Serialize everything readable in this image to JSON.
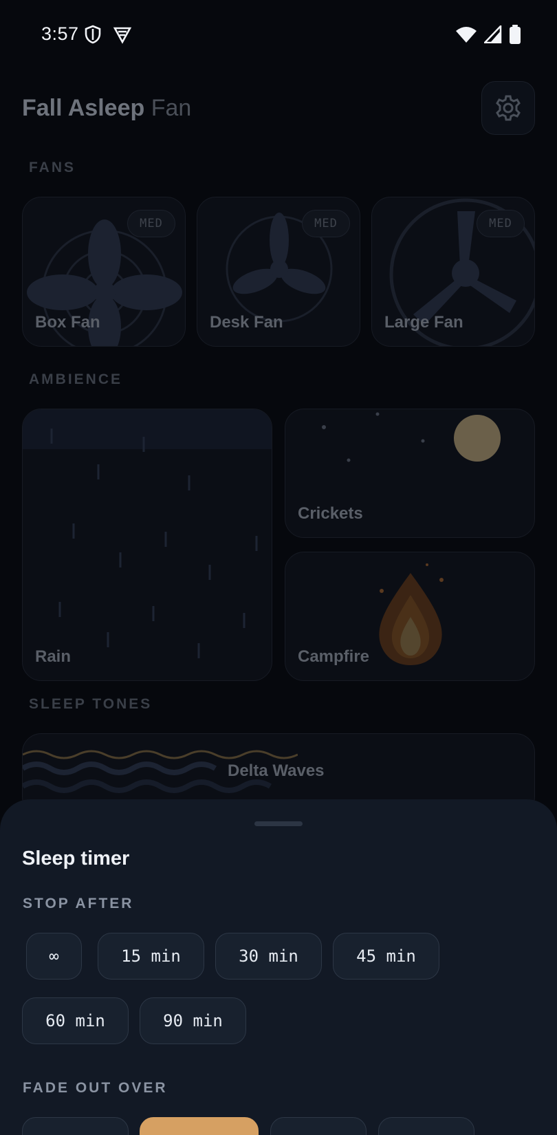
{
  "status_bar": {
    "time": "3:57"
  },
  "app": {
    "title_bold": "Fall Asleep",
    "title_light": "Fan",
    "sections": {
      "fans": "FANS",
      "ambience": "AMBIENCE",
      "sleep_tones": "SLEEP TONES"
    },
    "fans": [
      {
        "name": "Box Fan",
        "badge": "MED"
      },
      {
        "name": "Desk Fan",
        "badge": "MED"
      },
      {
        "name": "Large Fan",
        "badge": "MED"
      }
    ],
    "ambience": [
      {
        "name": "Rain"
      },
      {
        "name": "Crickets"
      },
      {
        "name": "Campfire"
      }
    ],
    "tones": [
      {
        "name": "Delta Waves"
      }
    ]
  },
  "sheet": {
    "title": "Sleep timer",
    "stop_after_label": "STOP AFTER",
    "stop_after_options": [
      "∞",
      "15 min",
      "30 min",
      "45 min",
      "60 min",
      "90 min"
    ],
    "fade_label": "FADE OUT OVER"
  },
  "colors": {
    "accent": "#d6a062",
    "sheet_bg": "#121925",
    "page_bg": "#06080d"
  }
}
